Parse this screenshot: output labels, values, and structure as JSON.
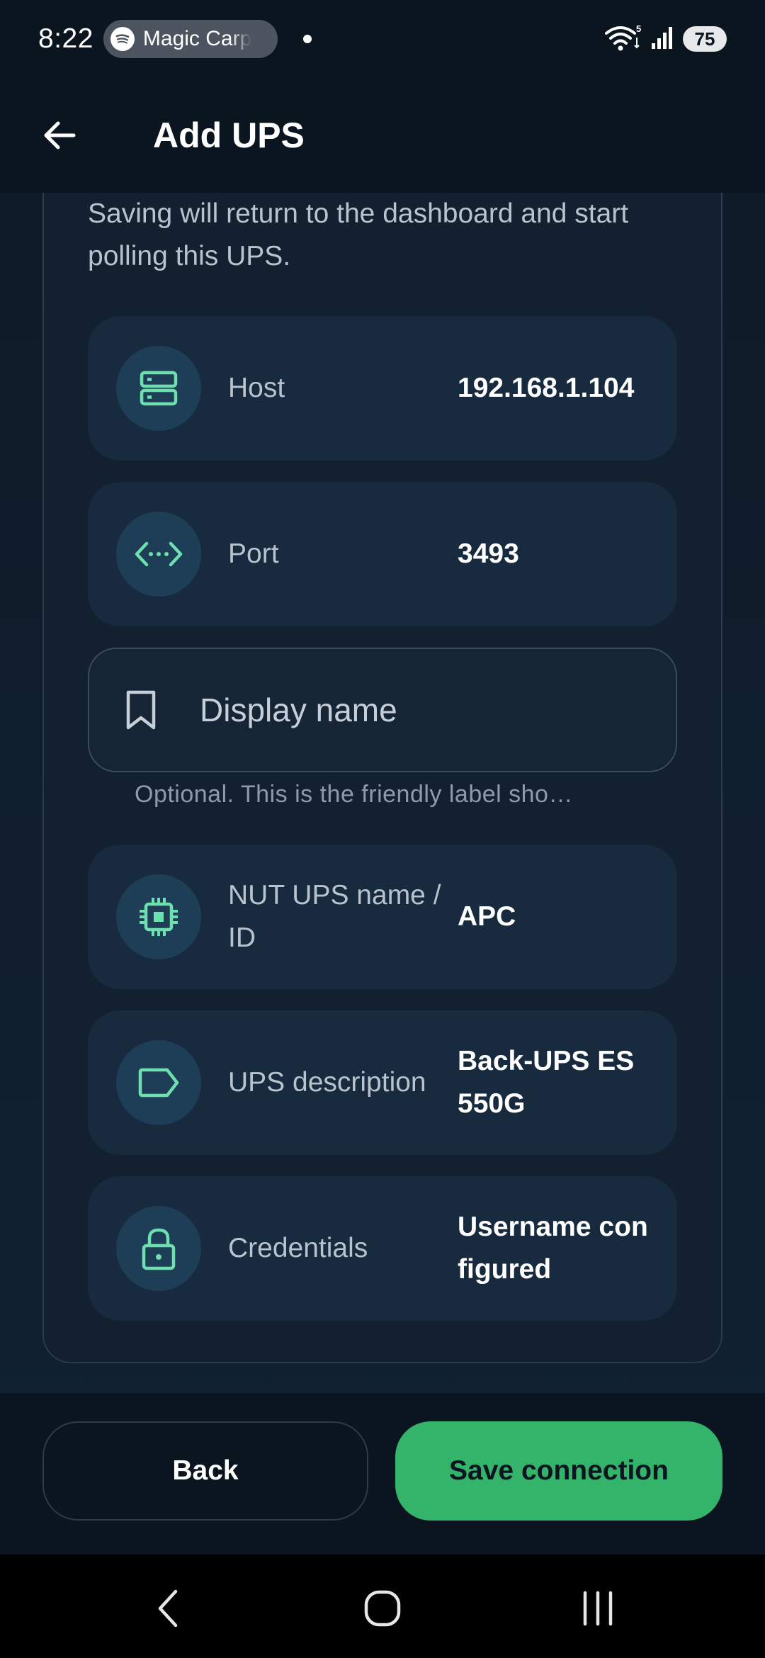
{
  "status_bar": {
    "time": "8:22",
    "media_app": "Magic Carp",
    "battery": "75",
    "network_badge": "5"
  },
  "app_bar": {
    "title": "Add UPS"
  },
  "intro_text": "Saving will return to the dashboard and start polling this UPS.",
  "fields": [
    {
      "label": "Host",
      "value": "192.168.1.104",
      "icon": "server-icon"
    },
    {
      "label": "Port",
      "value": "3493",
      "icon": "code-arrows-icon"
    },
    {
      "label": "NUT UPS name / ID",
      "value": "APC",
      "icon": "chip-icon"
    },
    {
      "label": "UPS description",
      "value": "Back-UPS ES 550G",
      "icon": "tag-icon"
    },
    {
      "label": "Credentials",
      "value": "Username configured",
      "icon": "lock-icon"
    }
  ],
  "display_name": {
    "placeholder": "Display name",
    "helper": "Optional. This is the friendly label sho…",
    "icon": "bookmark-icon"
  },
  "buttons": {
    "back": "Back",
    "save": "Save connection"
  },
  "colors": {
    "accent": "#34b36b",
    "icon_tint": "#6ee0b0",
    "background": "#0b1520",
    "row_bg": "#172a3e"
  }
}
